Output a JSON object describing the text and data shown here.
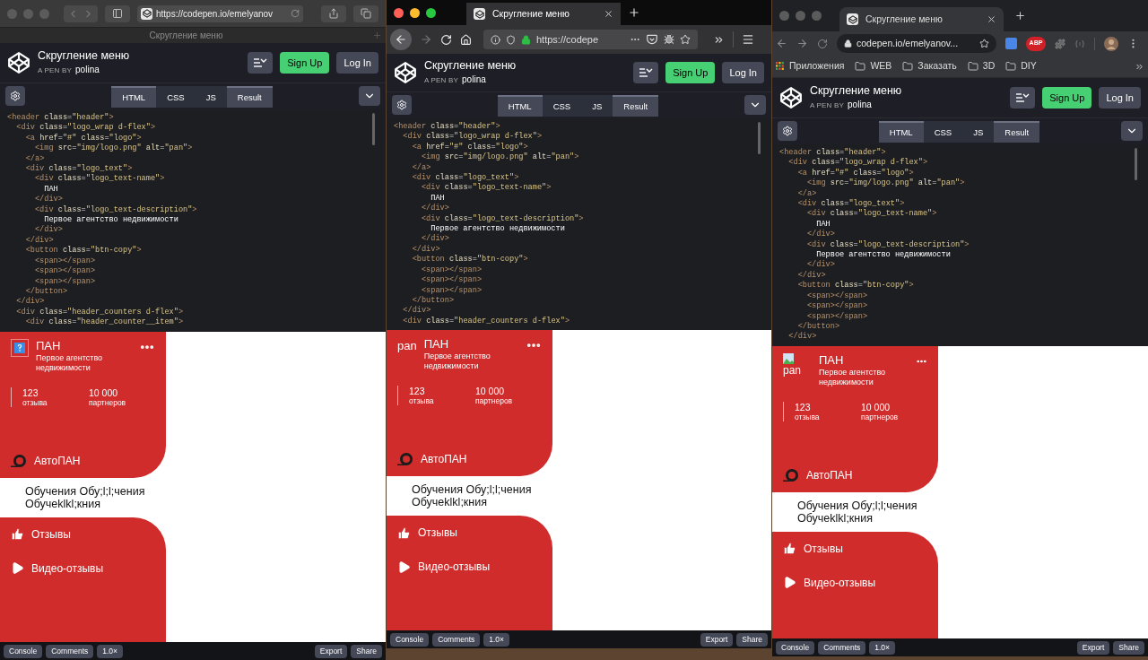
{
  "windows": [
    {
      "kind": "safari",
      "focused": false,
      "tab_title": "Скругление меню",
      "url": "https://codepen.io/emelyanov",
      "pen": {
        "title": "Скругление меню",
        "byline": "A PEN BY",
        "author": "polina",
        "sign_up": "Sign Up",
        "log_in": "Log In",
        "tabs": [
          {
            "label": "HTML",
            "selected": true
          },
          {
            "label": "CSS",
            "selected": false
          },
          {
            "label": "JS",
            "selected": false
          },
          {
            "label": "Result",
            "selected": true
          }
        ],
        "code": [
          "<header class=\"header\">",
          "  <div class=\"logo_wrap d-flex\">",
          "    <a href=\"#\" class=\"logo\">",
          "      <img src=\"img/logo.png\" alt=\"pan\">",
          "    </a>",
          "    <div class=\"logo_text\">",
          "      <div class=\"logo_text-name\">",
          "        ПАН",
          "      </div>",
          "      <div class=\"logo_text-description\">",
          "        Первое агентство недвижимости",
          "      </div>",
          "    </div>",
          "    <button class=\"btn-copy\">",
          "      <span></span>",
          "      <span></span>",
          "      <span></span>",
          "    </button>",
          "  </div>",
          "  <div class=\"header_counters d-flex\">",
          "    <div class=\"header_counter__item\">"
        ],
        "result": {
          "logo": {
            "kind": "broken-image"
          },
          "name": "ПАН",
          "description": "Первое агентство недвижимости",
          "counters": [
            {
              "value": "123",
              "label": "отзыва"
            },
            {
              "value": "10 000",
              "label": "партнеров"
            }
          ],
          "menu": [
            {
              "label": "АвтоПАН",
              "kind": "brand",
              "selected": false
            },
            {
              "label": "Обучения Обу;l;l;чения Обучеklkl;кния",
              "kind": "text",
              "selected": true
            },
            {
              "label": "Отзывы",
              "kind": "thumb",
              "selected": false
            },
            {
              "label": "Видео-отзывы",
              "kind": "play",
              "selected": false
            }
          ]
        },
        "footer_left": [
          "Console",
          "Comments",
          "1.0×"
        ],
        "footer_right": [
          "Export",
          "Share"
        ]
      }
    },
    {
      "kind": "firefox",
      "focused": true,
      "tab_title": "Скругление меню",
      "url": "https://codepe",
      "pen": {
        "title": "Скругление меню",
        "byline": "A PEN BY",
        "author": "polina",
        "sign_up": "Sign Up",
        "log_in": "Log In",
        "tabs": [
          {
            "label": "HTML",
            "selected": true
          },
          {
            "label": "CSS",
            "selected": false
          },
          {
            "label": "JS",
            "selected": false
          },
          {
            "label": "Result",
            "selected": true
          }
        ],
        "code": [
          "<header class=\"header\">",
          "  <div class=\"logo_wrap d-flex\">",
          "    <a href=\"#\" class=\"logo\">",
          "      <img src=\"img/logo.png\" alt=\"pan\">",
          "    </a>",
          "    <div class=\"logo_text\">",
          "      <div class=\"logo_text-name\">",
          "        ПАН",
          "      </div>",
          "      <div class=\"logo_text-description\">",
          "        Первое агентство недвижимости",
          "      </div>",
          "    </div>",
          "    <button class=\"btn-copy\">",
          "      <span></span>",
          "      <span></span>",
          "      <span></span>",
          "    </button>",
          "  </div>",
          "  <div class=\"header_counters d-flex\">"
        ],
        "result": {
          "logo": {
            "kind": "alt-text",
            "alt": "pan"
          },
          "name": "ПАН",
          "description": "Первое агентство недвижимости",
          "counters": [
            {
              "value": "123",
              "label": "отзыва"
            },
            {
              "value": "10 000",
              "label": "партнеров"
            }
          ],
          "menu": [
            {
              "label": "АвтоПАН",
              "kind": "brand",
              "selected": false
            },
            {
              "label": "Обучения Обу;l;l;чения Обучеklkl;кния",
              "kind": "text",
              "selected": true
            },
            {
              "label": "Отзывы",
              "kind": "thumb",
              "selected": false
            },
            {
              "label": "Видео-отзывы",
              "kind": "play",
              "selected": false
            }
          ]
        },
        "footer_left": [
          "Console",
          "Comments",
          "1.0×"
        ],
        "footer_right": [
          "Export",
          "Share"
        ]
      }
    },
    {
      "kind": "chrome",
      "focused": false,
      "tab_title": "Скругление меню",
      "url": "codepen.io/emelyanov...",
      "extension_label": "ABP",
      "bookmarks": [
        {
          "label": "Приложения",
          "kind": "apps"
        },
        {
          "label": "WEB",
          "kind": "folder"
        },
        {
          "label": "Заказать",
          "kind": "folder"
        },
        {
          "label": "3D",
          "kind": "folder"
        },
        {
          "label": "DIY",
          "kind": "folder"
        }
      ],
      "pen": {
        "title": "Скругление меню",
        "byline": "A PEN BY",
        "author": "polina",
        "sign_up": "Sign Up",
        "log_in": "Log In",
        "tabs": [
          {
            "label": "HTML",
            "selected": true
          },
          {
            "label": "CSS",
            "selected": false
          },
          {
            "label": "JS",
            "selected": false
          },
          {
            "label": "Result",
            "selected": true
          }
        ],
        "code": [
          "<header class=\"header\">",
          "  <div class=\"logo_wrap d-flex\">",
          "    <a href=\"#\" class=\"logo\">",
          "      <img src=\"img/logo.png\" alt=\"pan\">",
          "    </a>",
          "    <div class=\"logo_text\">",
          "      <div class=\"logo_text-name\">",
          "        ПАН",
          "      </div>",
          "      <div class=\"logo_text-description\">",
          "        Первое агентство недвижимости",
          "      </div>",
          "    </div>",
          "    <button class=\"btn-copy\">",
          "      <span></span>",
          "      <span></span>",
          "      <span></span>",
          "    </button>",
          "  </div>"
        ],
        "result": {
          "logo": {
            "kind": "broken-image-alt",
            "alt": "pan"
          },
          "name": "ПАН",
          "description": "Первое агентство недвижимости",
          "counters": [
            {
              "value": "123",
              "label": "отзыва"
            },
            {
              "value": "10 000",
              "label": "партнеров"
            }
          ],
          "menu": [
            {
              "label": "АвтоПАН",
              "kind": "brand",
              "selected": false
            },
            {
              "label": "Обучения Обу;l;l;чения Обучеklkl;кния",
              "kind": "text",
              "selected": true
            },
            {
              "label": "Отзывы",
              "kind": "thumb",
              "selected": false
            },
            {
              "label": "Видео-отзывы",
              "kind": "play",
              "selected": false
            }
          ]
        },
        "footer_left": [
          "Console",
          "Comments",
          "1.0×"
        ],
        "footer_right": [
          "Export",
          "Share"
        ]
      }
    }
  ]
}
